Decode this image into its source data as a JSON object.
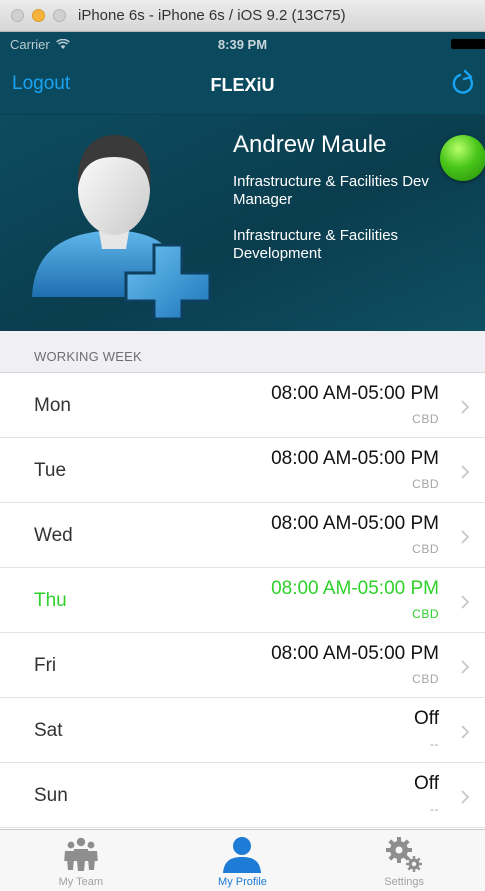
{
  "window": {
    "title": "iPhone 6s - iPhone 6s / iOS 9.2 (13C75)"
  },
  "statusbar": {
    "carrier": "Carrier",
    "time": "8:39 PM"
  },
  "nav": {
    "logout_label": "Logout",
    "title": "FLEXiU"
  },
  "profile": {
    "name": "Andrew Maule",
    "title": "Infrastructure & Facilities Dev Manager",
    "department": "Infrastructure & Facilities Development",
    "status_color": "#49c61a"
  },
  "section": {
    "header": "WORKING WEEK"
  },
  "week": [
    {
      "day": "Mon",
      "hours": "08:00 AM-05:00 PM",
      "location": "CBD",
      "today": false
    },
    {
      "day": "Tue",
      "hours": "08:00 AM-05:00 PM",
      "location": "CBD",
      "today": false
    },
    {
      "day": "Wed",
      "hours": "08:00 AM-05:00 PM",
      "location": "CBD",
      "today": false
    },
    {
      "day": "Thu",
      "hours": "08:00 AM-05:00 PM",
      "location": "CBD",
      "today": true
    },
    {
      "day": "Fri",
      "hours": "08:00 AM-05:00 PM",
      "location": "CBD",
      "today": false
    },
    {
      "day": "Sat",
      "hours": "Off",
      "location": "--",
      "today": false
    },
    {
      "day": "Sun",
      "hours": "Off",
      "location": "--",
      "today": false
    }
  ],
  "tabs": [
    {
      "label": "My Team",
      "icon": "team-icon",
      "active": false
    },
    {
      "label": "My Profile",
      "icon": "person-icon",
      "active": true
    },
    {
      "label": "Settings",
      "icon": "gears-icon",
      "active": false
    }
  ],
  "colors": {
    "brand": "#0b4a5e",
    "accent": "#1aa3f2",
    "today": "#2fd12b",
    "tab_active": "#1e7bd6"
  }
}
